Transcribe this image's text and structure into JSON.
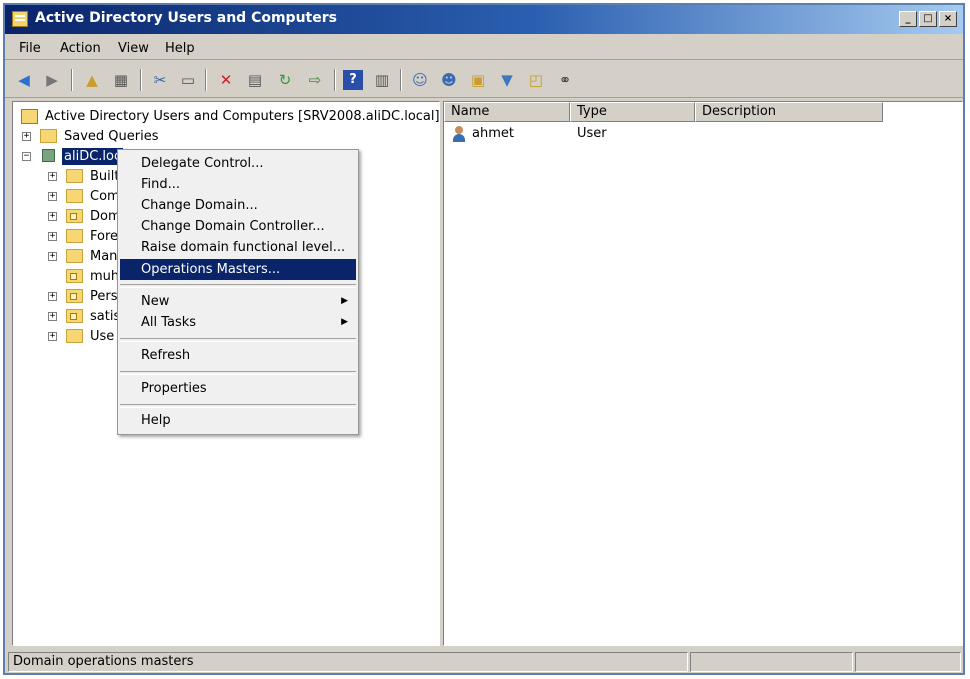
{
  "window": {
    "title": "Active Directory Users and Computers"
  },
  "window_buttons": {
    "minimize": "_",
    "maximize": "□",
    "close": "×"
  },
  "menubar": {
    "items": [
      "File",
      "Action",
      "View",
      "Help"
    ]
  },
  "toolbar": {
    "icons": [
      "back-arrow-icon",
      "forward-arrow-icon",
      "up-folder-icon",
      "show-console-tree-icon",
      "cut-icon",
      "paste-icon",
      "delete-icon",
      "properties-icon",
      "refresh-icon",
      "export-list-icon",
      "help-icon",
      "action-pane-icon",
      "new-user-icon",
      "new-group-icon",
      "new-ou-icon",
      "filter-icon",
      "find-icon",
      "delegate-icon"
    ]
  },
  "tree": {
    "root": "Active Directory Users and Computers [SRV2008.aliDC.local]",
    "saved_queries": "Saved Queries",
    "domain": "aliDC.loc",
    "children": [
      "Built",
      "Com",
      "Dom",
      "Fore",
      "Man",
      "muh",
      "Pers",
      "satis",
      "Use"
    ]
  },
  "list": {
    "columns": [
      "Name",
      "Type",
      "Description"
    ],
    "rows": [
      {
        "name": "ahmet",
        "type": "User",
        "description": ""
      }
    ]
  },
  "context_menu": {
    "items": [
      "Delegate Control...",
      "Find...",
      "Change Domain...",
      "Change Domain Controller...",
      "Raise domain functional level...",
      "Operations Masters...",
      "New",
      "All Tasks",
      "Refresh",
      "Properties",
      "Help"
    ],
    "highlighted": "Operations Masters...",
    "submenu_arrow": "▶"
  },
  "statusbar": {
    "text": "Domain operations masters"
  },
  "colors": {
    "selection": "#0a246a",
    "title_start": "#0a246a",
    "title_end": "#a6caf0",
    "chrome": "#d4d0c8"
  }
}
